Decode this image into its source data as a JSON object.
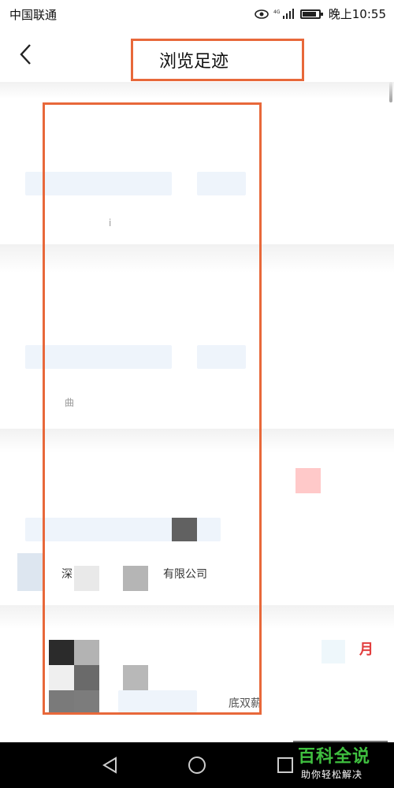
{
  "status_bar": {
    "carrier": "中国联通",
    "time": "晚上10:55",
    "network": "4G"
  },
  "header": {
    "title": "浏览足迹"
  },
  "content": {
    "company_fragment": "深",
    "company_suffix": "有限公司",
    "salary_fragment": "底双薪",
    "red_glyph": "月",
    "faint_glyph_1": "i",
    "faint_glyph_2": "曲"
  },
  "watermark": {
    "title": "百科全说",
    "subtitle": "助你轻松解决"
  },
  "colors": {
    "highlight": "#e8683a",
    "watermark_green": "#3fbf3f",
    "nav_bar": "#000000"
  }
}
